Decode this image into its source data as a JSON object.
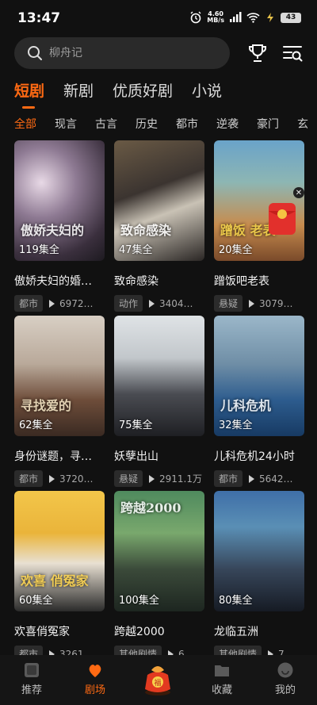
{
  "status": {
    "time": "13:47",
    "net_speed": "4.60",
    "net_unit": "MB/s",
    "battery": "43"
  },
  "search": {
    "placeholder": "柳舟记"
  },
  "main_tabs": [
    {
      "label": "短剧",
      "active": true
    },
    {
      "label": "新剧"
    },
    {
      "label": "优质好剧"
    },
    {
      "label": "小说"
    }
  ],
  "sub_tabs": [
    {
      "label": "全部",
      "active": true
    },
    {
      "label": "现言"
    },
    {
      "label": "古言"
    },
    {
      "label": "历史"
    },
    {
      "label": "都市"
    },
    {
      "label": "逆袭"
    },
    {
      "label": "豪门"
    },
    {
      "label": "玄"
    }
  ],
  "dramas": [
    {
      "title": "傲娇夫妇的婚…",
      "episodes": "119集全",
      "tag": "都市",
      "views": "6972…",
      "poster_text": "傲娇夫妇的"
    },
    {
      "title": "致命感染",
      "episodes": "47集全",
      "tag": "动作",
      "views": "3404…",
      "poster_text": "致命感染"
    },
    {
      "title": "蹭饭吧老表",
      "episodes": "20集全",
      "tag": "悬疑",
      "views": "3079…",
      "poster_text": "蹭饭 老表"
    },
    {
      "title": "身份谜题，寻…",
      "episodes": "62集全",
      "tag": "都市",
      "views": "3720…",
      "poster_text": "寻找爱的"
    },
    {
      "title": "妖孽出山",
      "episodes": "75集全",
      "tag": "悬疑",
      "views": "2911.1万",
      "poster_text": ""
    },
    {
      "title": "儿科危机24小时",
      "episodes": "32集全",
      "tag": "都市",
      "views": "5642…",
      "poster_text": "儿科危机"
    },
    {
      "title": "欢喜俏冤家",
      "episodes": "60集全",
      "tag": "都市",
      "views": "3261…",
      "poster_text": "欢喜 俏冤家"
    },
    {
      "title": "跨越2000",
      "episodes": "100集全",
      "tag": "其他剧情",
      "views": "6…",
      "poster_text": "跨越2000"
    },
    {
      "title": "龙临五洲",
      "episodes": "80集全",
      "tag": "其他剧情",
      "views": "7…",
      "poster_text": ""
    }
  ],
  "bottom_nav": [
    {
      "label": "推荐",
      "icon": "recommend-icon"
    },
    {
      "label": "剧场",
      "icon": "theater-icon",
      "active": true
    },
    {
      "label": "",
      "icon": "lucky-bag-icon"
    },
    {
      "label": "收藏",
      "icon": "folder-icon"
    },
    {
      "label": "我的",
      "icon": "profile-icon"
    }
  ],
  "colors": {
    "accent": "#ff6a13",
    "background": "#111111"
  }
}
